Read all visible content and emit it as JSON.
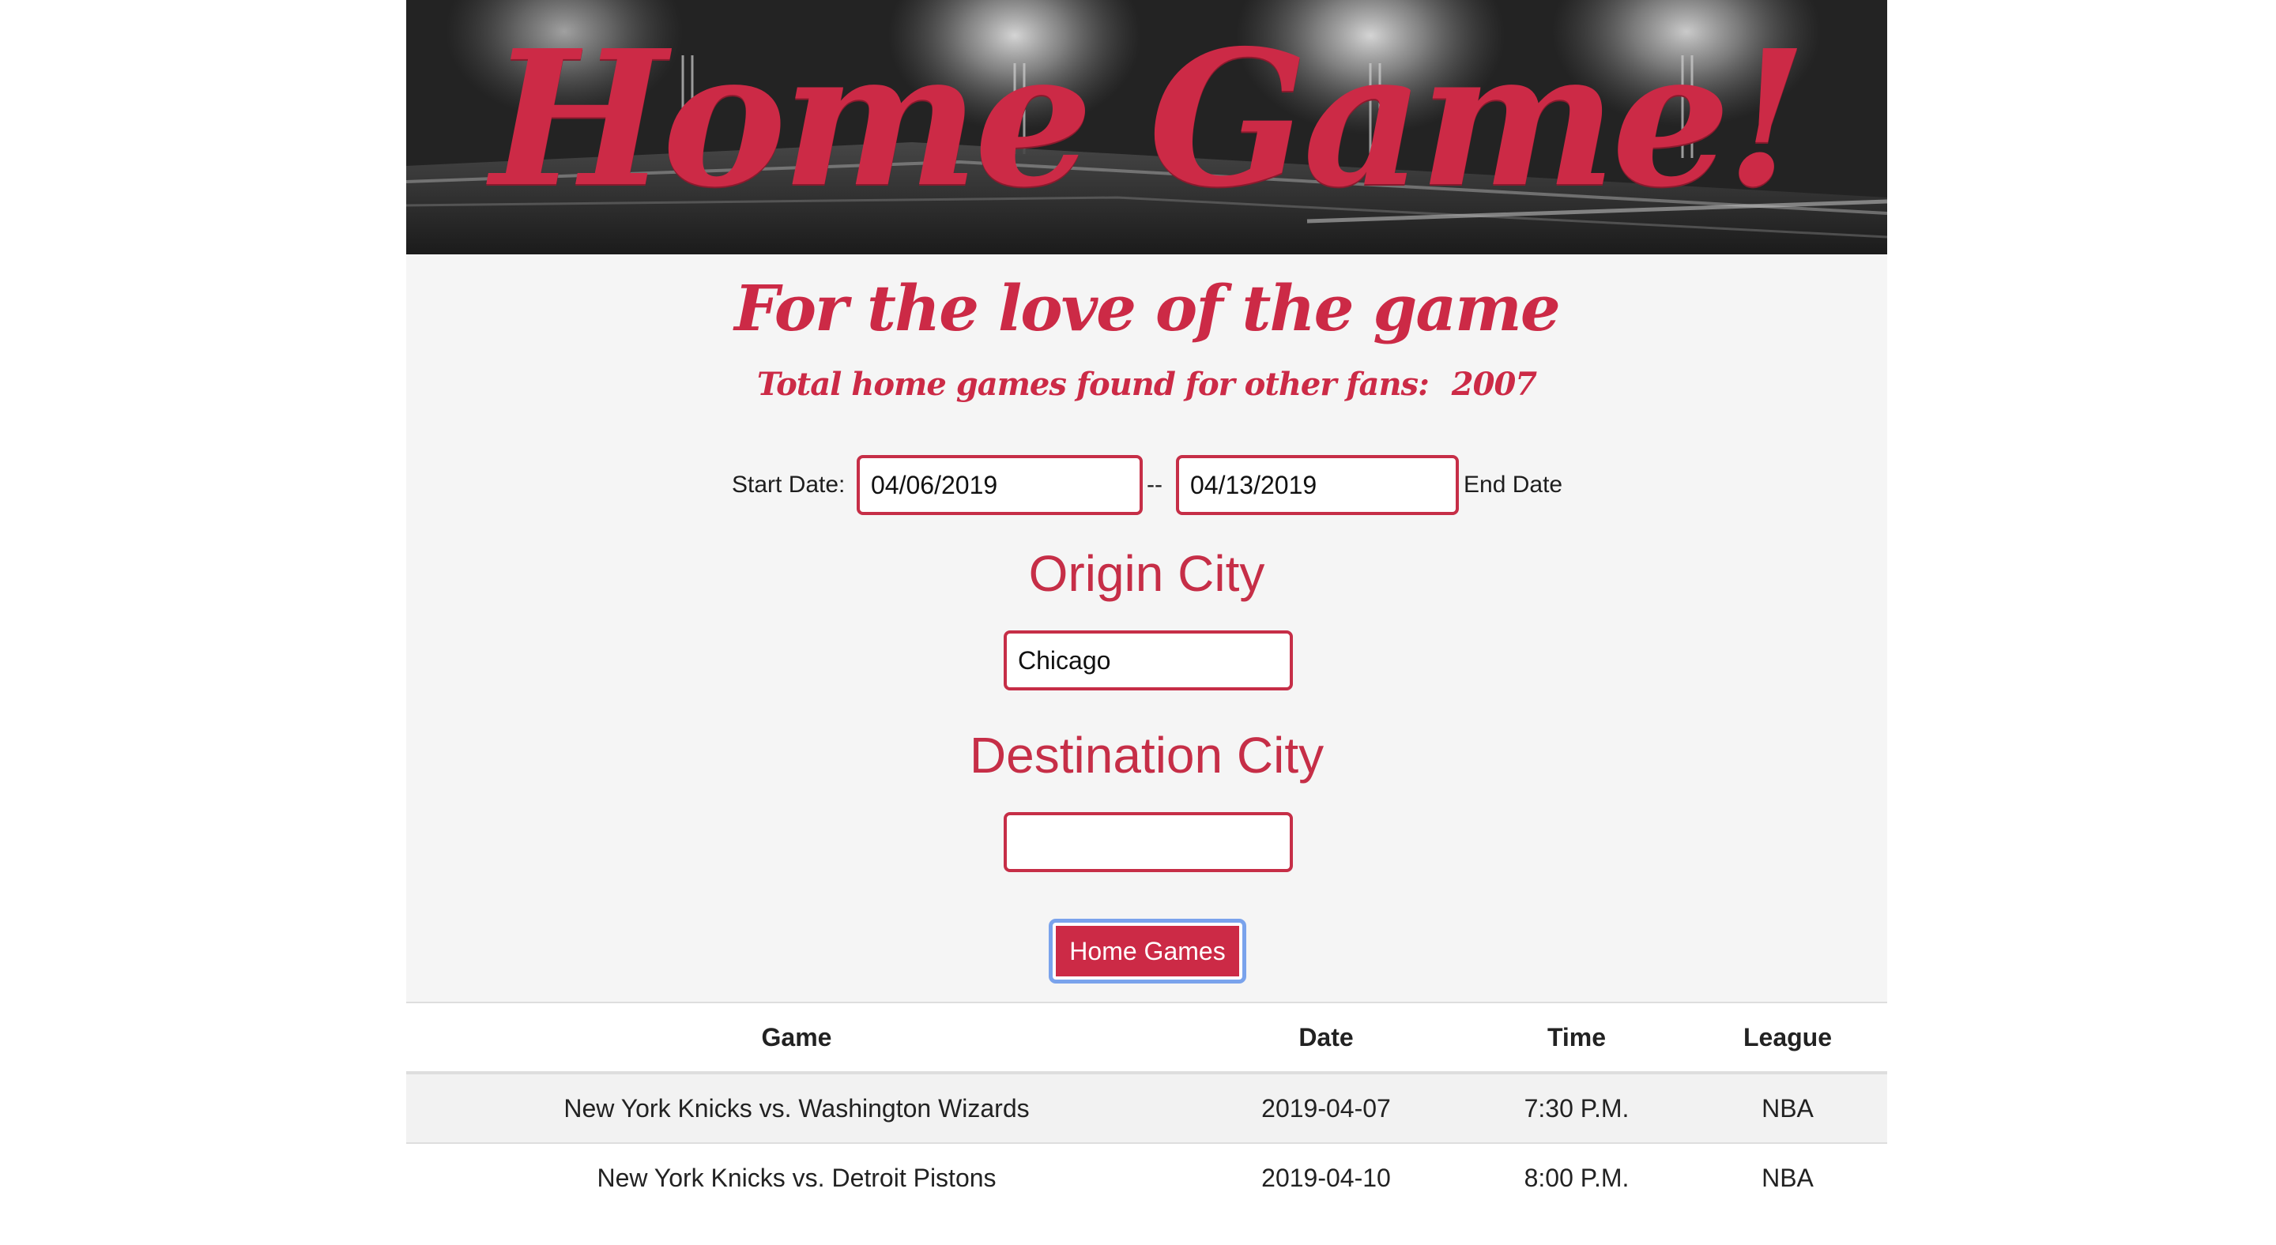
{
  "header": {
    "title": "Home Game!"
  },
  "hero": {
    "tagline": "For the love of the game",
    "fans_label": "Total home games found for other fans:",
    "fans_count": "2007"
  },
  "form": {
    "start_date_label": "Start Date:",
    "start_date_value": "04/06/2019",
    "separator": "--",
    "end_date_value": "04/13/2019",
    "end_date_label": "End Date",
    "origin_heading": "Origin City",
    "origin_value": "Chicago",
    "destination_heading": "Destination City",
    "destination_value": "",
    "submit_label": "Home Games"
  },
  "results": {
    "columns": [
      "Game",
      "Date",
      "Time",
      "League"
    ],
    "rows": [
      [
        "New York Knicks vs. Washington Wizards",
        "2019-04-07",
        "7:30 P.M.",
        "NBA"
      ],
      [
        "New York Knicks vs. Detroit Pistons",
        "2019-04-10",
        "8:00 P.M.",
        "NBA"
      ]
    ]
  },
  "colors": {
    "accent": "#cc2a46",
    "focus_ring": "#7aa3ec",
    "panel_background": "#f5f5f5"
  }
}
